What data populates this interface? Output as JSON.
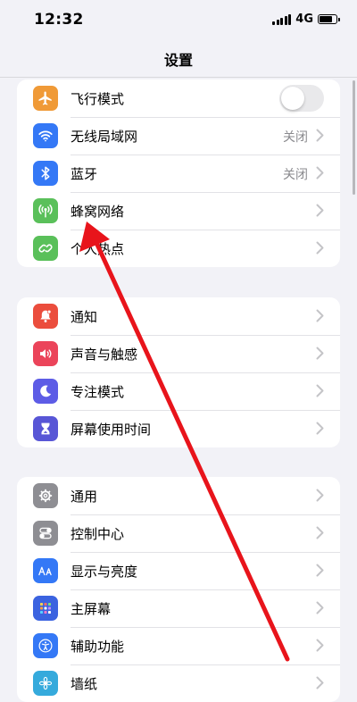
{
  "status_bar": {
    "time": "12:32",
    "network": "4G",
    "battery_level": 0.85
  },
  "nav": {
    "title": "设置"
  },
  "colors": {
    "orange": "#f09a37",
    "blue": "#3478f6",
    "green": "#5ac05a",
    "red": "#eb4d3d",
    "pink": "#eb445a",
    "indigo": "#5d5ce6",
    "purple": "#5856d6",
    "gray": "#8e8e93",
    "annotation_red": "#e8141b"
  },
  "groups": [
    {
      "rows": [
        {
          "icon": "airplane-icon",
          "label": "飞行模式",
          "control": "toggle",
          "toggle_on": false
        },
        {
          "icon": "wifi-icon",
          "label": "无线局域网",
          "value": "关闭"
        },
        {
          "icon": "bluetooth-icon",
          "label": "蓝牙",
          "value": "关闭"
        },
        {
          "icon": "cellular-icon",
          "label": "蜂窝网络"
        },
        {
          "icon": "hotspot-icon",
          "label": "个人热点"
        }
      ]
    },
    {
      "rows": [
        {
          "icon": "notification-icon",
          "label": "通知"
        },
        {
          "icon": "sound-icon",
          "label": "声音与触感"
        },
        {
          "icon": "moon-icon",
          "label": "专注模式"
        },
        {
          "icon": "hourglass-icon",
          "label": "屏幕使用时间"
        }
      ]
    },
    {
      "rows": [
        {
          "icon": "gear-icon",
          "label": "通用"
        },
        {
          "icon": "control-center-icon",
          "label": "控制中心"
        },
        {
          "icon": "display-icon",
          "label": "显示与亮度"
        },
        {
          "icon": "home-screen-icon",
          "label": "主屏幕"
        },
        {
          "icon": "accessibility-icon",
          "label": "辅助功能"
        },
        {
          "icon": "wallpaper-icon",
          "label": "墙纸"
        }
      ]
    }
  ]
}
